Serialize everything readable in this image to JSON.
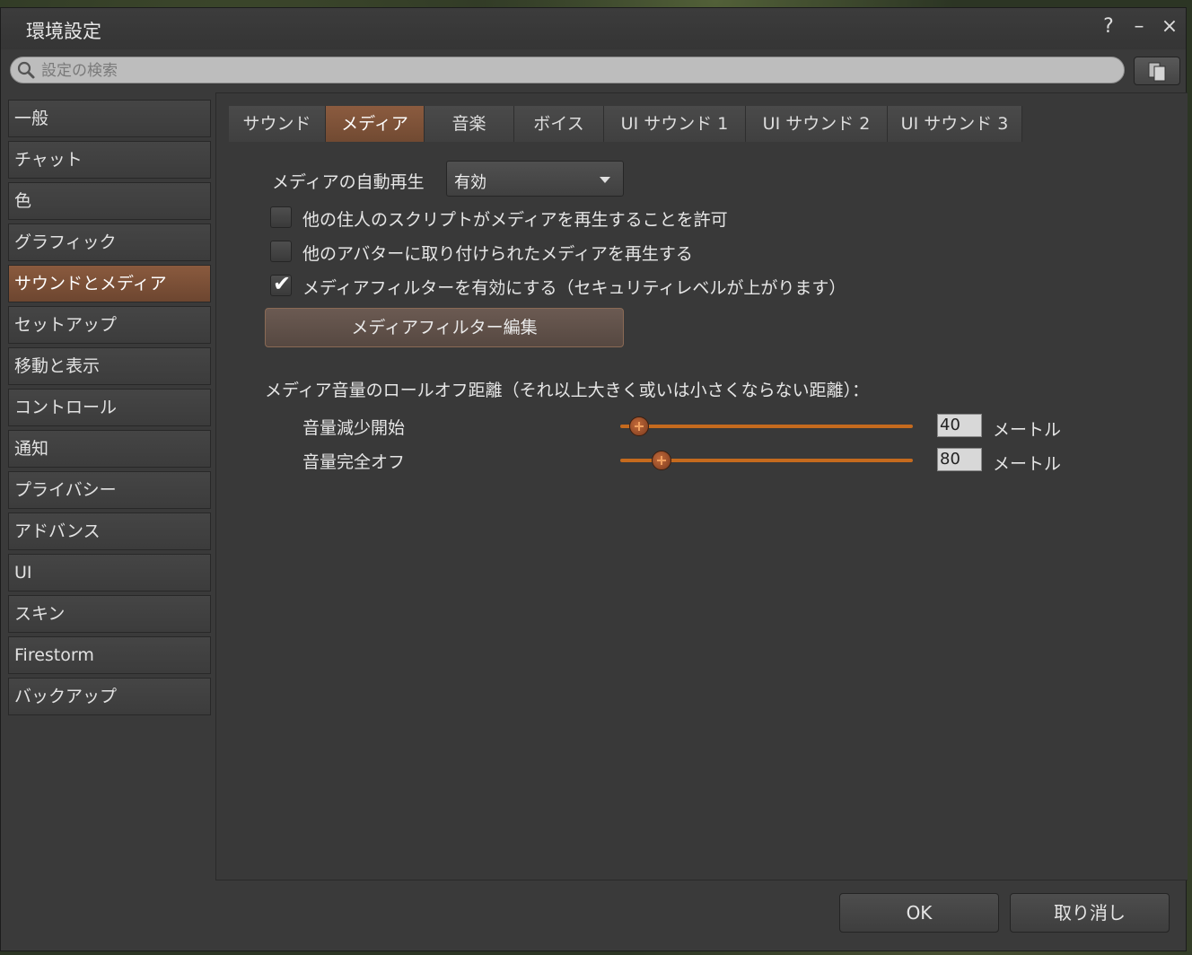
{
  "window": {
    "title": "環境設定",
    "help_icon": "?",
    "minimize_icon": "–",
    "close_icon": "×"
  },
  "search": {
    "placeholder": "設定の検索",
    "value": ""
  },
  "sidebar": {
    "items": [
      {
        "label": "一般"
      },
      {
        "label": "チャット"
      },
      {
        "label": "色"
      },
      {
        "label": "グラフィック"
      },
      {
        "label": "サウンドとメディア",
        "active": true
      },
      {
        "label": "セットアップ"
      },
      {
        "label": "移動と表示"
      },
      {
        "label": "コントロール"
      },
      {
        "label": "通知"
      },
      {
        "label": "プライバシー"
      },
      {
        "label": "アドバンス"
      },
      {
        "label": "UI"
      },
      {
        "label": "スキン"
      },
      {
        "label": "Firestorm"
      },
      {
        "label": "バックアップ"
      }
    ]
  },
  "tabs": [
    {
      "label": "サウンド"
    },
    {
      "label": "メディア",
      "active": true
    },
    {
      "label": "音楽"
    },
    {
      "label": "ボイス"
    },
    {
      "label": "UI サウンド 1"
    },
    {
      "label": "UI サウンド 2"
    },
    {
      "label": "UI サウンド 3"
    }
  ],
  "media": {
    "autoplay_label": "メディアの自動再生",
    "autoplay_value": "有効",
    "checkboxes": [
      {
        "label": "他の住人のスクリプトがメディアを再生することを許可",
        "checked": false
      },
      {
        "label": "他のアバターに取り付けられたメディアを再生する",
        "checked": false
      },
      {
        "label": "メディアフィルターを有効にする（セキュリティレベルが上がります）",
        "checked": true
      }
    ],
    "check_glyph": "✔",
    "filter_button": "メディアフィルター編集",
    "rolloff_heading": "メディア音量のロールオフ距離（それ以上大きく或いは小さくならない距離）：",
    "sliders": [
      {
        "label": "音量減少開始",
        "value": "40",
        "unit": "メートル",
        "fraction": 0.065
      },
      {
        "label": "音量完全オフ",
        "value": "80",
        "unit": "メートル",
        "fraction": 0.14
      }
    ]
  },
  "buttons": {
    "ok": "OK",
    "cancel": "取り消し"
  },
  "colors": {
    "accent": "#8a5a3e",
    "slider_track": "#c56a1e",
    "panel_bg": "#393939"
  }
}
